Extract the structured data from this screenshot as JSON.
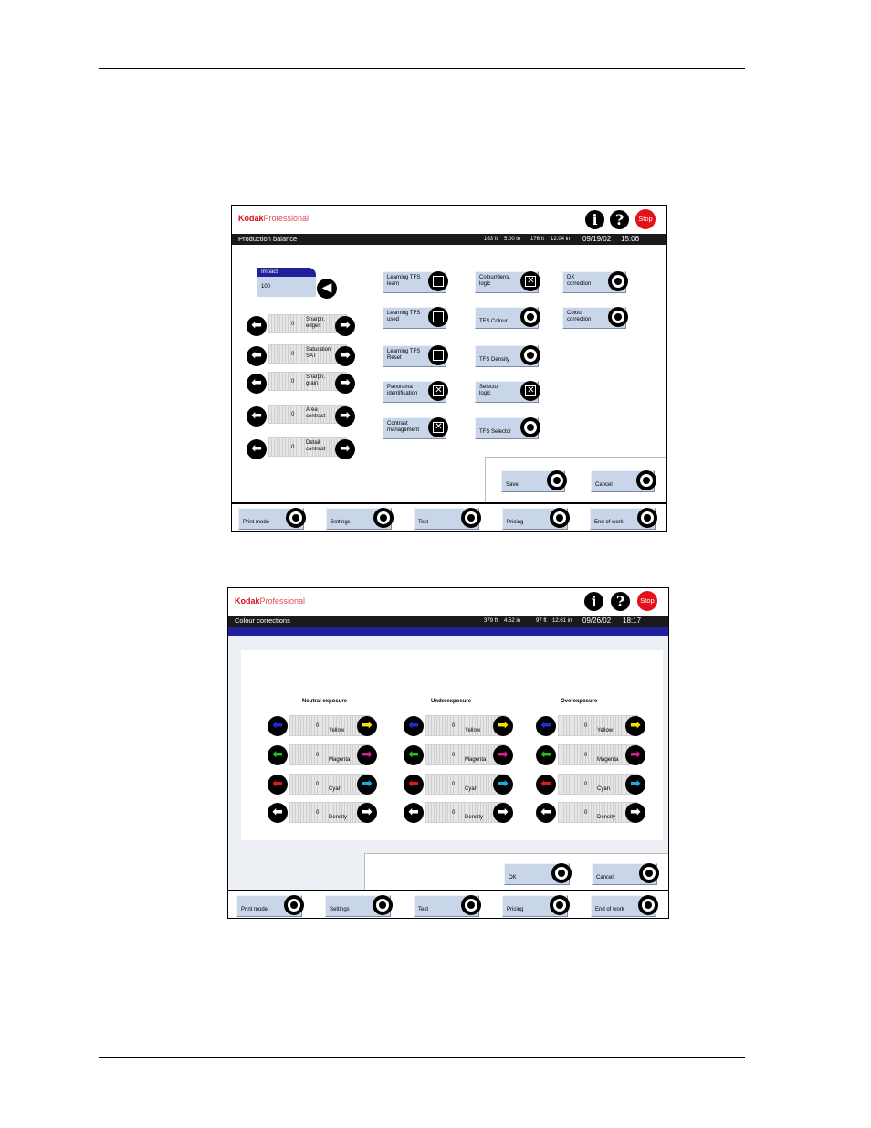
{
  "screen1": {
    "brand": {
      "kodak": "Kodak",
      "professional": "Professional"
    },
    "icons": {
      "info": "i",
      "help": "?",
      "stop": "Stop"
    },
    "title": "Production balance",
    "status": {
      "left": "163 ft",
      "left_in": "5.00 in",
      "mid": "176 ft",
      "mid_in": "12.04 in",
      "date": "09/19/02",
      "time": "15:06"
    },
    "impact": {
      "label": "Impact",
      "value": "100"
    },
    "sliders": [
      {
        "value": "0",
        "label1": "Sharpn.",
        "label2": "edges"
      },
      {
        "value": "0",
        "label1": "Saturation",
        "label2": "SAT"
      },
      {
        "value": "0",
        "label1": "Sharpn.",
        "label2": "grain"
      },
      {
        "value": "0",
        "label1": "Area",
        "label2": "contrast"
      },
      {
        "value": "0",
        "label1": "Detail",
        "label2": "contrast"
      }
    ],
    "col1": [
      {
        "l1": "Learning TFS",
        "l2": "learn"
      },
      {
        "l1": "Learning TFS",
        "l2": "used"
      },
      {
        "l1": "Learning TFS",
        "l2": "Reset"
      },
      {
        "l1": "Panorama",
        "l2": "identification"
      },
      {
        "l1": "Contrast",
        "l2": "management"
      }
    ],
    "col2": [
      {
        "l1": "Colour/dens.",
        "l2": "logic"
      },
      {
        "l1": "",
        "l2": "TFS Colour"
      },
      {
        "l1": "",
        "l2": "TFS Density"
      },
      {
        "l1": "Selector",
        "l2": "logic"
      },
      {
        "l1": "",
        "l2": "TFS Selector"
      }
    ],
    "col3": [
      {
        "l1": "DX",
        "l2": "correction"
      },
      {
        "l1": "Colour",
        "l2": "correction"
      }
    ],
    "save": "Save",
    "cancel": "Cancel",
    "bottom": [
      "Print mode",
      "Settings",
      "Test",
      "Pricing",
      "End of work"
    ]
  },
  "screen2": {
    "brand": {
      "kodak": "Kodak",
      "professional": "Professional"
    },
    "icons": {
      "info": "i",
      "help": "?",
      "stop": "Stop"
    },
    "title": "Colour corrections",
    "status": {
      "left": "379 ft",
      "left_in": "4.52 in",
      "mid": "97 ft",
      "mid_in": "12.61 in",
      "date": "09/26/02",
      "time": "18:17"
    },
    "columns": [
      "Neutral exposure",
      "Underexposure",
      "Overexposure"
    ],
    "rows": [
      {
        "value": "0",
        "label": "Yellow"
      },
      {
        "value": "0",
        "label": "Magenta"
      },
      {
        "value": "0",
        "label": "Cyan"
      },
      {
        "value": "0",
        "label": "Density"
      }
    ],
    "ok": "OK",
    "cancel": "Cancel",
    "bottom": [
      "Print mode",
      "Settings",
      "Test",
      "Pricing",
      "End of work"
    ],
    "arrow_colors": {
      "yellow_left": "#1a2fd8",
      "yellow_right": "#f2e200",
      "magenta_left": "#1ec21e",
      "magenta_right": "#d6208a",
      "cyan_left": "#e01818",
      "cyan_right": "#20a8e0",
      "density_left": "#ffffff",
      "density_right": "#ffffff"
    }
  }
}
